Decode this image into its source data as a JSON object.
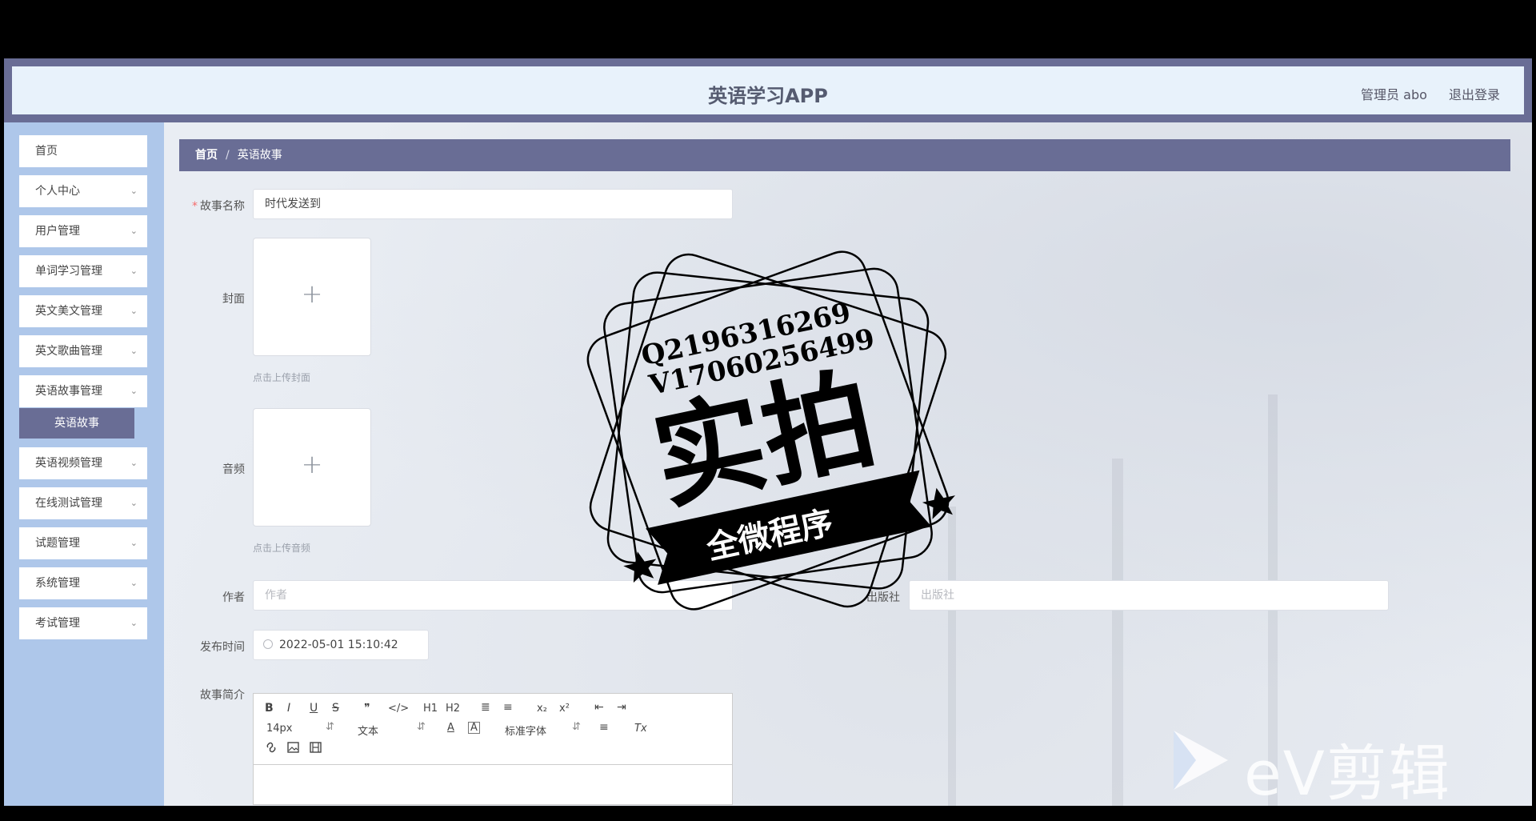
{
  "header": {
    "title": "英语学习APP",
    "admin_label": "管理员 abo",
    "logout_label": "退出登录"
  },
  "sidebar": {
    "items": [
      {
        "label": "首页"
      },
      {
        "label": "个人中心"
      },
      {
        "label": "用户管理"
      },
      {
        "label": "单词学习管理"
      },
      {
        "label": "英文美文管理"
      },
      {
        "label": "英文歌曲管理"
      },
      {
        "label": "英语故事管理"
      },
      {
        "label": "英语视频管理"
      },
      {
        "label": "在线测试管理"
      },
      {
        "label": "试题管理"
      },
      {
        "label": "系统管理"
      },
      {
        "label": "考试管理"
      }
    ],
    "active_sub_item": "英语故事"
  },
  "breadcrumb": {
    "home": "首页",
    "separator": "/",
    "current": "英语故事"
  },
  "form": {
    "story_name": {
      "label": "故事名称",
      "required_mark": "*",
      "value": "时代发送到"
    },
    "cover": {
      "label": "封面",
      "hint": "点击上传封面"
    },
    "audio": {
      "label": "音频",
      "hint": "点击上传音频"
    },
    "author": {
      "label": "作者",
      "placeholder": "作者"
    },
    "publisher": {
      "label": "出版社",
      "placeholder": "出版社"
    },
    "publish_time": {
      "label": "发布时间",
      "value": "2022-05-01 15:10:42"
    },
    "summary": {
      "label": "故事简介"
    }
  },
  "editor_toolbar": {
    "font_size": "14px",
    "header_select": "文本",
    "font_family": "标准字体",
    "buttons": [
      "B",
      "I",
      "U",
      "S",
      "❞",
      "</>",
      "H1",
      "H2",
      "≣",
      "≡",
      "x₂",
      "x²",
      "⇤",
      "⇥",
      "A",
      "A",
      "≡",
      "Tx"
    ]
  },
  "watermark": {
    "stamp_line1": "Q2196316269",
    "stamp_line2": "V17060256499",
    "stamp_main": "实拍",
    "stamp_banner": "全微程序",
    "ev_text": "eV剪辑"
  },
  "colors": {
    "header_purple": "#696d95",
    "header_inner": "#e8f2fb",
    "sidebar_blue": "#aec7ea",
    "required_red": "#f56c6c"
  }
}
